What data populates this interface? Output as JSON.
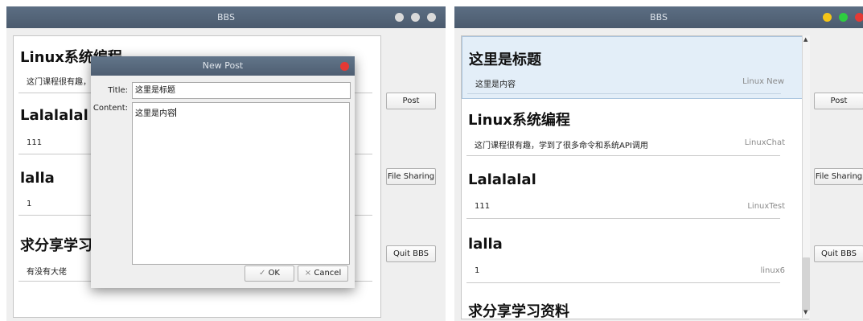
{
  "colors": {
    "close": "#e53935",
    "minimize": "#f5c518",
    "maximize": "#2ecc40",
    "grey_dot": "#dadada",
    "selected": "#e3eef8"
  },
  "left_window": {
    "title": "BBS",
    "posts": [
      {
        "title": "Linux系统编程",
        "body": "这门课程很有趣，学"
      },
      {
        "title": "Lalalalal",
        "body": "111"
      },
      {
        "title": "lalla",
        "body": "1"
      },
      {
        "title": "求分享学习资",
        "body": "有没有大佬"
      }
    ],
    "buttons": {
      "post": "Post",
      "file_sharing": "File Sharing",
      "quit": "Quit BBS"
    },
    "dialog": {
      "title": "New Post",
      "title_label": "Title:",
      "title_value": "这里是标题",
      "content_label": "Content:",
      "content_value": "这里是内容",
      "ok_label": "OK",
      "ok_icon": "✓",
      "cancel_label": "Cancel",
      "cancel_icon": "×"
    }
  },
  "right_window": {
    "title": "BBS",
    "posts": [
      {
        "title": "这里是标题",
        "body": "这里是内容",
        "author": "Linux New"
      },
      {
        "title": "Linux系统编程",
        "body": "这门课程很有趣，学到了很多命令和系统API调用",
        "author": "LinuxChat"
      },
      {
        "title": "Lalalalal",
        "body": "111",
        "author": "LinuxTest"
      },
      {
        "title": "lalla",
        "body": "1",
        "author": "linux6"
      },
      {
        "title": "求分享学习资料",
        "body": "",
        "author": ""
      }
    ],
    "buttons": {
      "post": "Post",
      "file_sharing": "File Sharing",
      "quit": "Quit BBS"
    }
  }
}
